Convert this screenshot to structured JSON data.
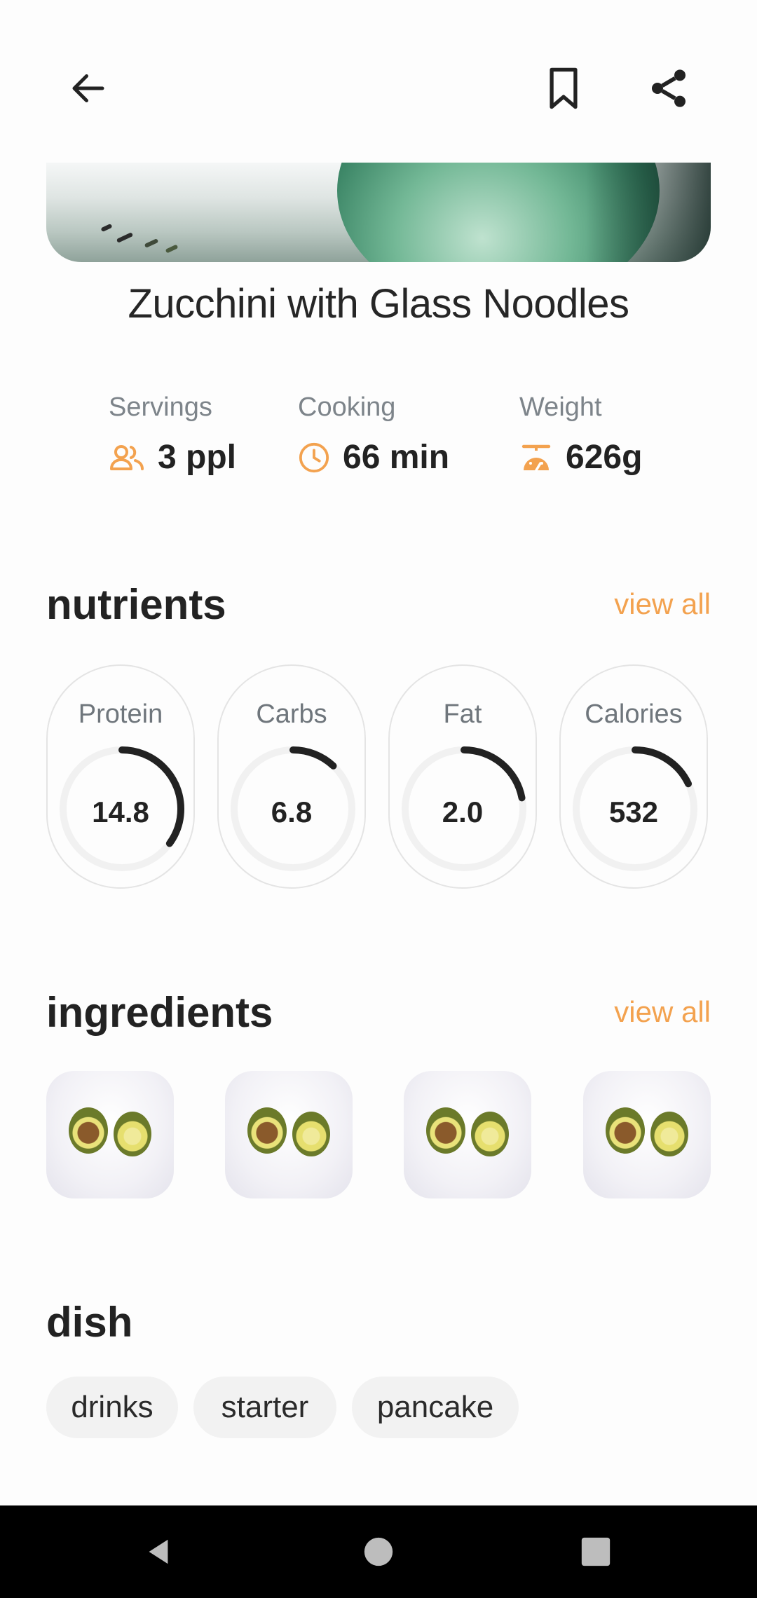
{
  "recipe": {
    "title": "Zucchini with Glass Noodles",
    "stats": [
      {
        "label": "Servings",
        "value": "3 ppl",
        "icon": "people-icon"
      },
      {
        "label": "Cooking",
        "value": "66 min",
        "icon": "clock-icon"
      },
      {
        "label": "Weight",
        "value": "626g",
        "icon": "scale-icon"
      }
    ]
  },
  "nutrients": {
    "title": "nutrients",
    "view_all": "view all",
    "items": [
      {
        "label": "Protein",
        "value": "14.8",
        "progress": 0.35
      },
      {
        "label": "Carbs",
        "value": "6.8",
        "progress": 0.12
      },
      {
        "label": "Fat",
        "value": "2.0",
        "progress": 0.22
      },
      {
        "label": "Calories",
        "value": "532",
        "progress": 0.18
      }
    ]
  },
  "ingredients": {
    "title": "ingredients",
    "view_all": "view all",
    "items": [
      {
        "image": "avocado"
      },
      {
        "image": "avocado"
      },
      {
        "image": "avocado"
      },
      {
        "image": "avocado"
      }
    ]
  },
  "dish": {
    "title": "dish",
    "tags": [
      "drinks",
      "starter",
      "pancake"
    ]
  },
  "colors": {
    "accent": "#f3a24f",
    "text": "#222222",
    "muted": "#7d848a",
    "ring": "#222222",
    "ring_track": "#f1f1f1"
  }
}
